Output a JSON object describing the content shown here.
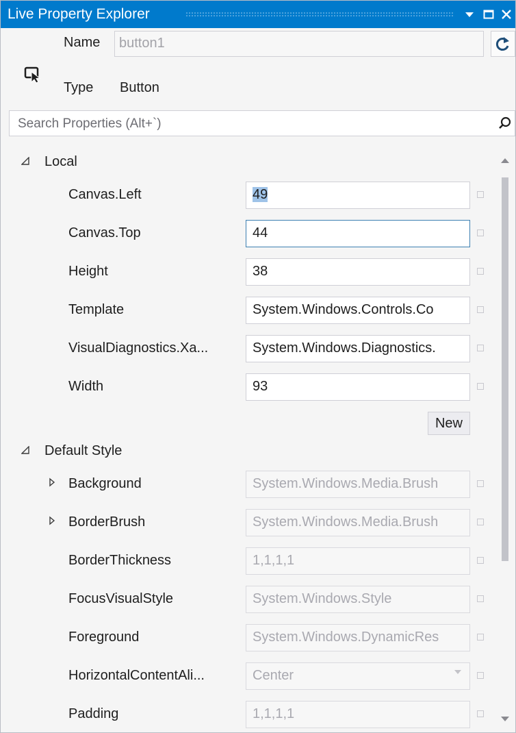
{
  "window": {
    "title": "Live Property Explorer"
  },
  "header": {
    "name_label": "Name",
    "name_value": "button1",
    "type_label": "Type",
    "type_value": "Button"
  },
  "search": {
    "placeholder": "Search Properties (Alt+`)"
  },
  "sections": {
    "local": {
      "label": "Local",
      "rows": [
        {
          "name": "Canvas.Left",
          "value": "49"
        },
        {
          "name": "Canvas.Top",
          "value": "44"
        },
        {
          "name": "Height",
          "value": "38"
        },
        {
          "name": "Template",
          "value": "System.Windows.Controls.Co"
        },
        {
          "name": "VisualDiagnostics.Xa...",
          "value": "System.Windows.Diagnostics."
        },
        {
          "name": "Width",
          "value": "93"
        }
      ],
      "new_button": "New"
    },
    "default_style": {
      "label": "Default Style",
      "rows": [
        {
          "name": "Background",
          "value": "System.Windows.Media.Brush"
        },
        {
          "name": "BorderBrush",
          "value": "System.Windows.Media.Brush"
        },
        {
          "name": "BorderThickness",
          "value": "1,1,1,1"
        },
        {
          "name": "FocusVisualStyle",
          "value": "System.Windows.Style"
        },
        {
          "name": "Foreground",
          "value": "System.Windows.DynamicRes"
        },
        {
          "name": "HorizontalContentAli...",
          "value": "Center"
        },
        {
          "name": "Padding",
          "value": "1,1,1,1"
        }
      ]
    }
  },
  "colors": {
    "titlebar": "#007acc",
    "background": "#f5f5f5",
    "selection": "#9fc3e8"
  }
}
